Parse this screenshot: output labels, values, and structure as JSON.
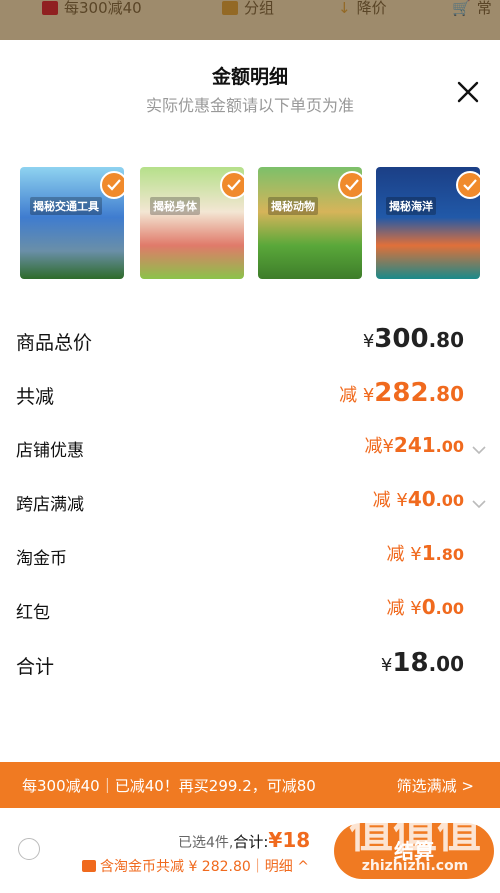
{
  "topbar": {
    "coupon_text": "每300减40",
    "group_label": "分组",
    "price_drop_label": "降价",
    "cart_label": "常"
  },
  "sheet": {
    "title": "金额明细",
    "subtitle": "实际优惠金额请以下单页为准"
  },
  "books": [
    {
      "title": "揭秘交通工具",
      "color": "#3f7ccf"
    },
    {
      "title": "揭秘身体",
      "color": "#8bc34a"
    },
    {
      "title": "揭秘动物",
      "color": "#5aa83a"
    },
    {
      "title": "揭秘海洋",
      "color": "#2159a8"
    }
  ],
  "rows": {
    "total_goods": {
      "label": "商品总价",
      "currency": "¥",
      "int": "300",
      "dec": ".80"
    },
    "total_reduce": {
      "label": "共减",
      "prefix": "减",
      "currency": "¥",
      "int": "282",
      "dec": ".80"
    },
    "shop_discount": {
      "label": "店铺优惠",
      "prefix": "减",
      "currency": "¥",
      "int": "241",
      "dec": ".00"
    },
    "cross_shop": {
      "label": "跨店满减",
      "prefix": "减",
      "currency": "¥",
      "int": "40",
      "dec": ".00"
    },
    "taojinbi": {
      "label": "淘金币",
      "prefix": "减",
      "currency": "¥",
      "int": "1",
      "dec": ".80"
    },
    "hongbao": {
      "label": "红包",
      "prefix": "减",
      "currency": "¥",
      "int": "0",
      "dec": ".00"
    },
    "subtotal": {
      "label": "合计",
      "currency": "¥",
      "int": "18",
      "dec": ".00"
    }
  },
  "promo": {
    "text": "每300减40｜已减40！再买299.2，可减80",
    "link": "筛选满减 >"
  },
  "bottom": {
    "selected_text": "已选4件,",
    "total_label": "合计:",
    "total_value": "¥18",
    "detail_text": "含淘金币共减 ¥ 282.80｜明细 ^",
    "checkout_label": "结算"
  },
  "watermark": {
    "big": "值值值",
    "small": "zhizhizhi.com"
  },
  "colors": {
    "accent": "#f07a22",
    "reduce_text": "#f06a1e"
  }
}
